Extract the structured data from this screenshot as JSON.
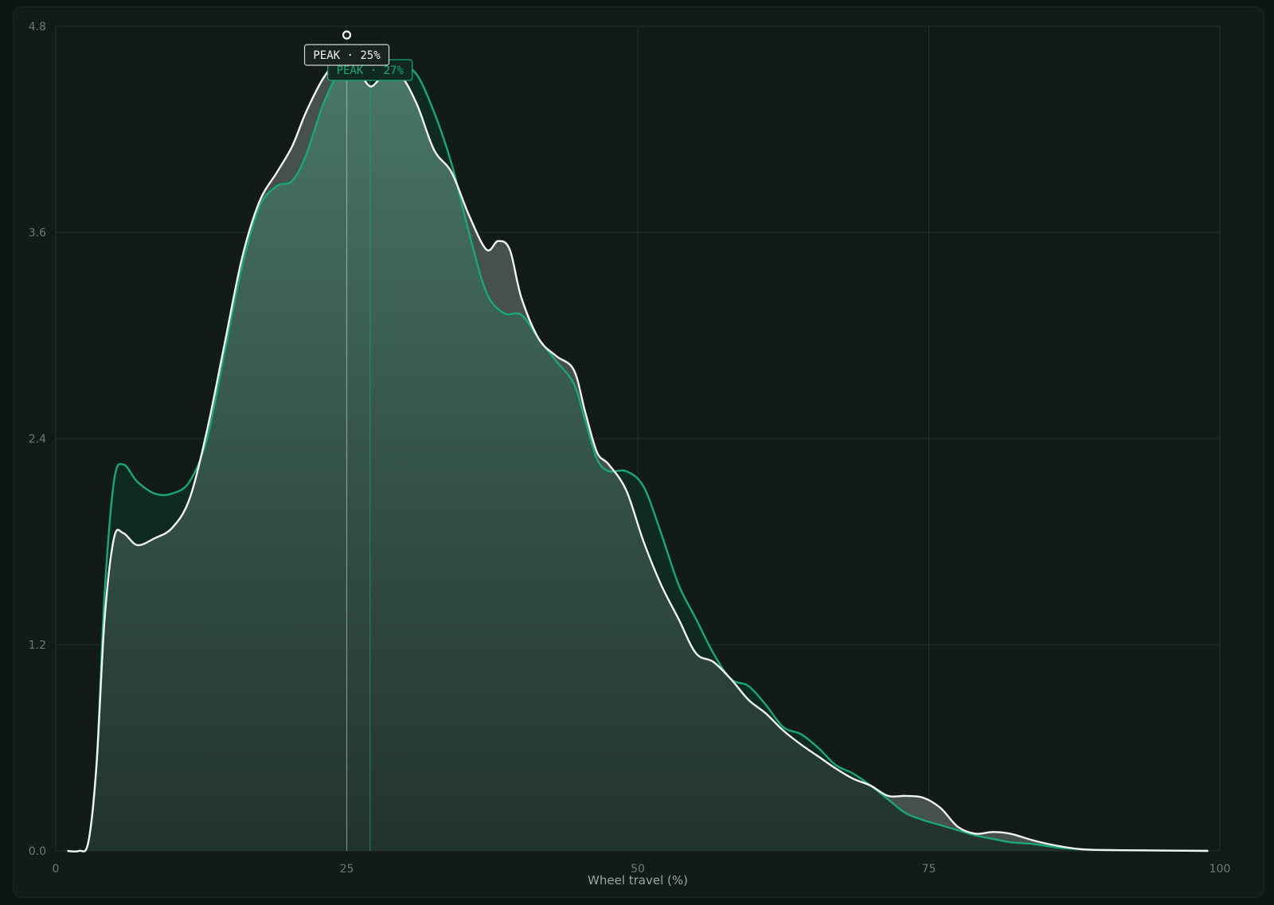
{
  "chart_data": {
    "type": "area",
    "xlabel": "Wheel travel (%)",
    "ylabel": "",
    "xlim": [
      0,
      100
    ],
    "ylim": [
      0,
      4.8
    ],
    "x_ticks": [
      0,
      25,
      50,
      75,
      100
    ],
    "y_ticks": [
      "0.0",
      "1.2",
      "2.4",
      "3.6",
      "4.8"
    ],
    "grid": true,
    "series": [
      {
        "color": "#1aa874",
        "peak_x": 27,
        "peak_label": "PEAK · 27%",
        "points": [
          [
            1,
            0
          ],
          [
            2,
            0
          ],
          [
            2.8,
            0.05
          ],
          [
            3.5,
            0.5
          ],
          [
            4.2,
            1.5
          ],
          [
            5,
            2.15
          ],
          [
            5.8,
            2.25
          ],
          [
            7,
            2.15
          ],
          [
            8.5,
            2.08
          ],
          [
            10,
            2.08
          ],
          [
            11.5,
            2.15
          ],
          [
            13,
            2.4
          ],
          [
            14.5,
            2.9
          ],
          [
            16,
            3.4
          ],
          [
            17.5,
            3.75
          ],
          [
            19,
            3.87
          ],
          [
            20.3,
            3.9
          ],
          [
            21.5,
            4.05
          ],
          [
            23,
            4.35
          ],
          [
            24.5,
            4.55
          ],
          [
            26,
            4.62
          ],
          [
            27,
            4.65
          ],
          [
            28,
            4.61
          ],
          [
            29.5,
            4.58
          ],
          [
            31,
            4.52
          ],
          [
            32.5,
            4.3
          ],
          [
            34,
            4.0
          ],
          [
            35.5,
            3.6
          ],
          [
            37,
            3.25
          ],
          [
            38.5,
            3.13
          ],
          [
            40,
            3.12
          ],
          [
            41.5,
            2.98
          ],
          [
            43,
            2.85
          ],
          [
            44.5,
            2.72
          ],
          [
            45.5,
            2.5
          ],
          [
            46.5,
            2.28
          ],
          [
            47.5,
            2.21
          ],
          [
            49,
            2.21
          ],
          [
            50.5,
            2.12
          ],
          [
            52,
            1.85
          ],
          [
            53.5,
            1.55
          ],
          [
            55,
            1.35
          ],
          [
            56.5,
            1.15
          ],
          [
            58,
            1.0
          ],
          [
            59.5,
            0.96
          ],
          [
            61,
            0.85
          ],
          [
            62.5,
            0.72
          ],
          [
            64,
            0.68
          ],
          [
            65.5,
            0.6
          ],
          [
            67,
            0.5
          ],
          [
            68.5,
            0.45
          ],
          [
            70,
            0.38
          ],
          [
            71.5,
            0.3
          ],
          [
            73,
            0.22
          ],
          [
            74.5,
            0.18
          ],
          [
            76,
            0.15
          ],
          [
            77.5,
            0.12
          ],
          [
            79,
            0.09
          ],
          [
            80.5,
            0.07
          ],
          [
            82,
            0.05
          ],
          [
            84,
            0.04
          ],
          [
            86,
            0.02
          ],
          [
            88,
            0.01
          ],
          [
            90,
            0.005
          ],
          [
            95,
            0.002
          ],
          [
            99,
            0
          ]
        ]
      },
      {
        "color": "#f2f4f3",
        "peak_x": 25,
        "peak_label": "PEAK · 25%",
        "points": [
          [
            1,
            0
          ],
          [
            2,
            0
          ],
          [
            2.8,
            0.05
          ],
          [
            3.5,
            0.5
          ],
          [
            4.2,
            1.35
          ],
          [
            5,
            1.82
          ],
          [
            5.8,
            1.85
          ],
          [
            7,
            1.78
          ],
          [
            8.5,
            1.82
          ],
          [
            10,
            1.88
          ],
          [
            11.5,
            2.05
          ],
          [
            13,
            2.45
          ],
          [
            14.5,
            2.95
          ],
          [
            16,
            3.45
          ],
          [
            17.5,
            3.78
          ],
          [
            19,
            3.95
          ],
          [
            20.3,
            4.1
          ],
          [
            21.5,
            4.3
          ],
          [
            23,
            4.5
          ],
          [
            24.5,
            4.62
          ],
          [
            25.2,
            4.64
          ],
          [
            26,
            4.55
          ],
          [
            27,
            4.45
          ],
          [
            28,
            4.5
          ],
          [
            29.5,
            4.52
          ],
          [
            31,
            4.35
          ],
          [
            32.5,
            4.08
          ],
          [
            34,
            3.95
          ],
          [
            35.5,
            3.7
          ],
          [
            37,
            3.5
          ],
          [
            38,
            3.55
          ],
          [
            39,
            3.5
          ],
          [
            40,
            3.22
          ],
          [
            41.5,
            2.98
          ],
          [
            43,
            2.88
          ],
          [
            44.5,
            2.8
          ],
          [
            45.5,
            2.55
          ],
          [
            46.5,
            2.32
          ],
          [
            47.5,
            2.25
          ],
          [
            49,
            2.1
          ],
          [
            50.5,
            1.8
          ],
          [
            52,
            1.55
          ],
          [
            53.5,
            1.35
          ],
          [
            55,
            1.15
          ],
          [
            56.5,
            1.1
          ],
          [
            58,
            1.0
          ],
          [
            59.5,
            0.88
          ],
          [
            61,
            0.8
          ],
          [
            62.5,
            0.7
          ],
          [
            64,
            0.62
          ],
          [
            65.5,
            0.55
          ],
          [
            67,
            0.48
          ],
          [
            68.5,
            0.42
          ],
          [
            70,
            0.38
          ],
          [
            71.5,
            0.32
          ],
          [
            73,
            0.32
          ],
          [
            74.5,
            0.31
          ],
          [
            76,
            0.25
          ],
          [
            77.5,
            0.14
          ],
          [
            79,
            0.1
          ],
          [
            80.5,
            0.11
          ],
          [
            82,
            0.1
          ],
          [
            84,
            0.06
          ],
          [
            86,
            0.03
          ],
          [
            88,
            0.01
          ],
          [
            90,
            0.005
          ],
          [
            95,
            0.002
          ],
          [
            99,
            0
          ]
        ]
      }
    ]
  }
}
